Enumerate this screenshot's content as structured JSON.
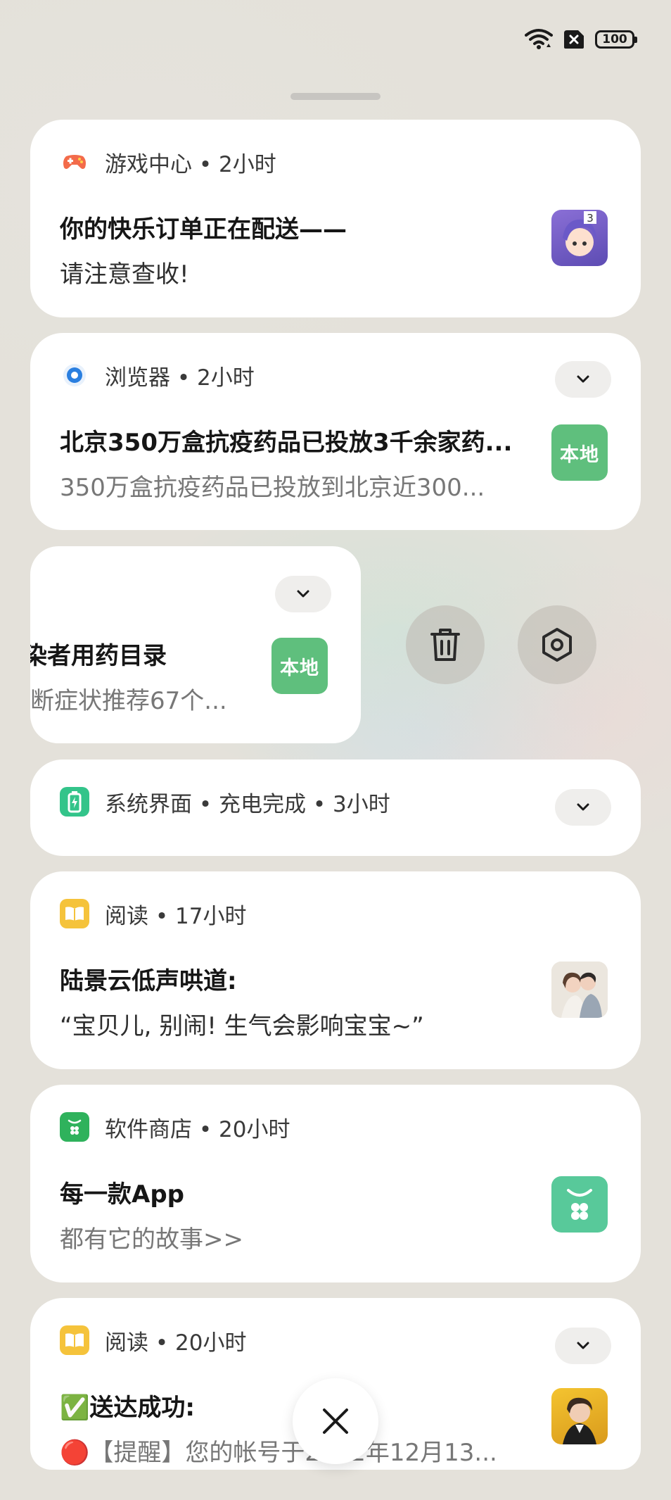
{
  "status_bar": {
    "battery": "100",
    "wifi_icon": "wifi-icon",
    "sim_icon": "no-sim-icon"
  },
  "notifications": [
    {
      "app": "游戏中心",
      "time": "2小时",
      "meta": "游戏中心 • 2小时",
      "title": "你的快乐订单正在配送——",
      "body": "请注意查收!",
      "thumb": "anime-character-avatar"
    },
    {
      "app": "浏览器",
      "time": "2小时",
      "meta": "浏览器 • 2小时",
      "title": "北京350万盒抗疫药品已投放3千余家药...",
      "body": "350万盒抗疫药品已投放到北京近300...",
      "thumb_label": "本地"
    },
    {
      "title": "染者用药目录",
      "body": "断症状推荐67个...",
      "thumb_label": "本地"
    },
    {
      "app": "系统界面",
      "meta": "系统界面 • 充电完成 • 3小时"
    },
    {
      "app": "阅读",
      "time": "17小时",
      "meta": "阅读 • 17小时",
      "title": "陆景云低声哄道:",
      "body": "“宝贝儿, 别闹! 生气会影响宝宝~”",
      "thumb": "couple-illustration"
    },
    {
      "app": "软件商店",
      "time": "20小时",
      "meta": "软件商店 • 20小时",
      "title": "每一款App",
      "body": "都有它的故事>>",
      "thumb": "store-icon"
    },
    {
      "app": "阅读",
      "time": "20小时",
      "meta": "阅读 • 20小时",
      "title": "✅送达成功:",
      "body": "🔴【提醒】您的帐号于2022年12月13..."
    }
  ],
  "swipe_actions": {
    "delete_icon": "trash-icon",
    "settings_icon": "settings-hexagon-icon"
  },
  "colors": {
    "accent_green": "#5fbf7d",
    "store_green": "#58c99a",
    "game_orange": "#f36b4a",
    "browser_blue": "#2a7fe0",
    "reading_yellow": "#f5c33b",
    "system_green": "#33c48a"
  }
}
